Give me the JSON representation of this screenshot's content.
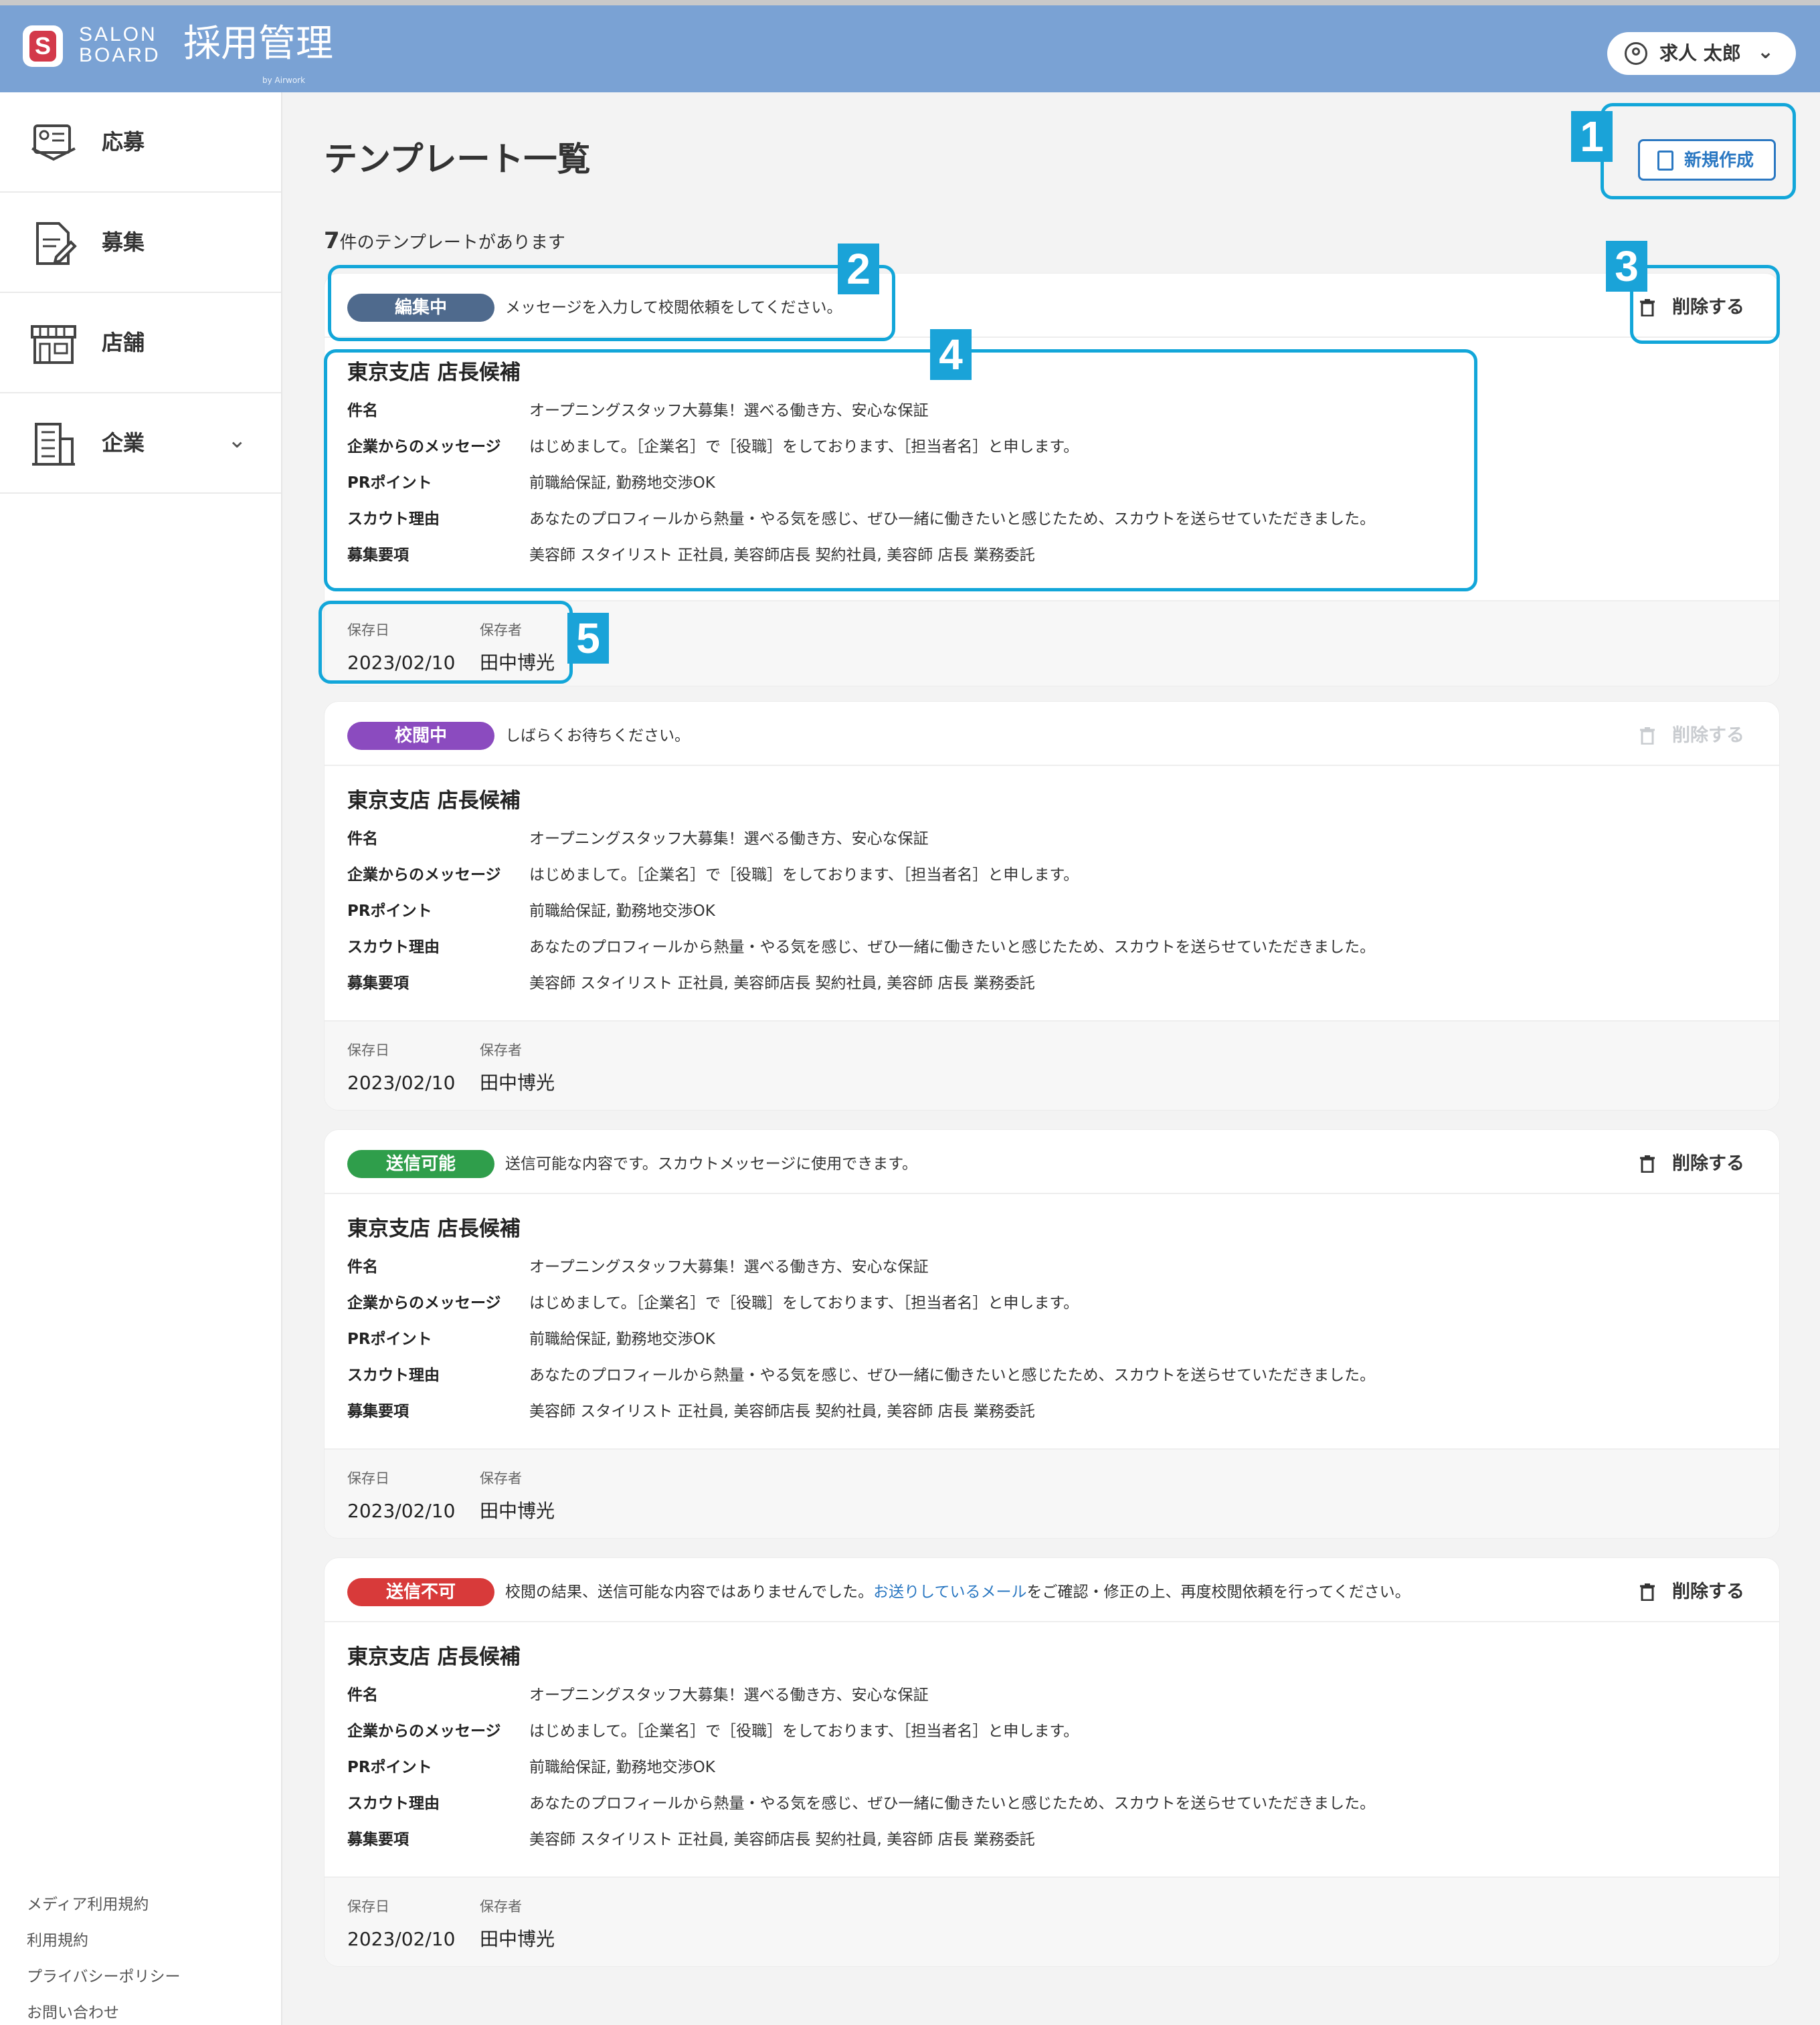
{
  "header": {
    "brand_line1": "SALON",
    "brand_line2": "BOARD",
    "app_title": "採用管理",
    "by_text": "by Airwork",
    "user_name": "求人 太郎",
    "colors": {
      "header_bg": "#7aa2d4",
      "accent": "#2b78c2"
    }
  },
  "sidebar": {
    "items": [
      {
        "label": "応募",
        "icon": "application-icon"
      },
      {
        "label": "募集",
        "icon": "edit-document-icon"
      },
      {
        "label": "店舗",
        "icon": "store-icon"
      },
      {
        "label": "企業",
        "icon": "building-icon",
        "expandable": true
      }
    ],
    "footer_links": [
      "メディア利用規約",
      "利用規約",
      "プライバシーポリシー",
      "お問い合わせ"
    ]
  },
  "main": {
    "title": "テンプレート一覧",
    "new_button": "新規作成",
    "count_number": "7",
    "count_suffix": "件のテンプレートがあります",
    "delete_label": "削除する",
    "field_labels": {
      "subject": "件名",
      "message": "企業からのメッセージ",
      "pr": "PRポイント",
      "reason": "スカウト理由",
      "requirements": "募集要項"
    },
    "saved_date_label": "保存日",
    "saved_by_label": "保存者",
    "templates": [
      {
        "status": "編集中",
        "status_color": "#4f6a8d",
        "status_message": "メッセージを入力して校閲依頼をしてください。",
        "delete_enabled": true,
        "title": "東京支店 店長候補",
        "subject": "オープニングスタッフ大募集！選べる働き方、安心な保証",
        "message": "はじめまして。［企業名］で［役職］をしております、［担当者名］と申します。",
        "pr": "前職給保証, 勤務地交渉OK",
        "reason": "あなたのプロフィールから熱量・やる気を感じ、ぜひ一緒に働きたいと感じたため、スカウトを送らせていただきました。",
        "requirements": "美容師 スタイリスト 正社員, 美容師店長 契約社員, 美容師 店長 業務委託",
        "saved_date": "2023/02/10",
        "saved_by": "田中博光"
      },
      {
        "status": "校閲中",
        "status_color": "#8b4bbf",
        "status_message": "しばらくお待ちください。",
        "delete_enabled": false,
        "title": "東京支店 店長候補",
        "subject": "オープニングスタッフ大募集！選べる働き方、安心な保証",
        "message": "はじめまして。［企業名］で［役職］をしております、［担当者名］と申します。",
        "pr": "前職給保証, 勤務地交渉OK",
        "reason": "あなたのプロフィールから熱量・やる気を感じ、ぜひ一緒に働きたいと感じたため、スカウトを送らせていただきました。",
        "requirements": "美容師 スタイリスト 正社員, 美容師店長 契約社員, 美容師 店長 業務委託",
        "saved_date": "2023/02/10",
        "saved_by": "田中博光"
      },
      {
        "status": "送信可能",
        "status_color": "#2f9e4b",
        "status_message": "送信可能な内容です。スカウトメッセージに使用できます。",
        "delete_enabled": true,
        "title": "東京支店 店長候補",
        "subject": "オープニングスタッフ大募集！選べる働き方、安心な保証",
        "message": "はじめまして。［企業名］で［役職］をしております、［担当者名］と申します。",
        "pr": "前職給保証, 勤務地交渉OK",
        "reason": "あなたのプロフィールから熱量・やる気を感じ、ぜひ一緒に働きたいと感じたため、スカウトを送らせていただきました。",
        "requirements": "美容師 スタイリスト 正社員, 美容師店長 契約社員, 美容師 店長 業務委託",
        "saved_date": "2023/02/10",
        "saved_by": "田中博光"
      },
      {
        "status": "送信不可",
        "status_color": "#d83a3a",
        "status_message_before": "校閲の結果、送信可能な内容ではありませんでした。",
        "status_message_link": "お送りしているメール",
        "status_message_after": "をご確認・修正の上、再度校閲依頼を行ってください。",
        "delete_enabled": true,
        "title": "東京支店 店長候補",
        "subject": "オープニングスタッフ大募集！選べる働き方、安心な保証",
        "message": "はじめまして。［企業名］で［役職］をしております、［担当者名］と申します。",
        "pr": "前職給保証, 勤務地交渉OK",
        "reason": "あなたのプロフィールから熱量・やる気を感じ、ぜひ一緒に働きたいと感じたため、スカウトを送らせていただきました。",
        "requirements": "美容師 スタイリスト 正社員, 美容師店長 契約社員, 美容師 店長 業務委託",
        "saved_date": "2023/02/10",
        "saved_by": "田中博光"
      }
    ]
  },
  "annotations": [
    "1",
    "2",
    "3",
    "4",
    "5"
  ]
}
